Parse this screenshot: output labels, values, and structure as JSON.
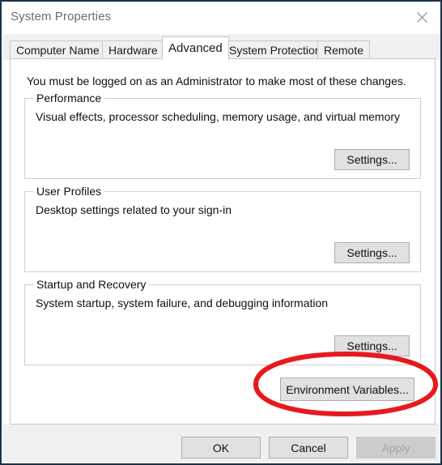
{
  "window": {
    "title": "System Properties",
    "close_icon": "close-icon"
  },
  "tabs": [
    {
      "label": "Computer Name",
      "selected": false
    },
    {
      "label": "Hardware",
      "selected": false
    },
    {
      "label": "Advanced",
      "selected": true
    },
    {
      "label": "System Protection",
      "selected": false
    },
    {
      "label": "Remote",
      "selected": false
    }
  ],
  "content": {
    "admin_notice": "You must be logged on as an Administrator to make most of these changes.",
    "groups": [
      {
        "label": "Performance",
        "description": "Visual effects, processor scheduling, memory usage, and virtual memory",
        "button_label": "Settings..."
      },
      {
        "label": "User Profiles",
        "description": "Desktop settings related to your sign-in",
        "button_label": "Settings..."
      },
      {
        "label": "Startup and Recovery",
        "description": "System startup, system failure, and debugging information",
        "button_label": "Settings..."
      }
    ],
    "environment_variables_label": "Environment Variables..."
  },
  "annotation": {
    "shape": "ellipse",
    "color": "#e8191e",
    "stroke_width": 6,
    "targets": "environment-variables-button"
  },
  "footer": {
    "ok_label": "OK",
    "cancel_label": "Cancel",
    "apply_label": "Apply",
    "apply_enabled": false
  },
  "colors": {
    "window_border": "#1c3048",
    "title_text": "#6c6c6c",
    "tab_strip_bg": "#f0f0f0",
    "panel_bg": "#ffffff",
    "button_face": "#e1e1e1",
    "button_border": "#adadad",
    "disabled_text": "#a6a6a6",
    "annotation_red": "#e8191e"
  }
}
